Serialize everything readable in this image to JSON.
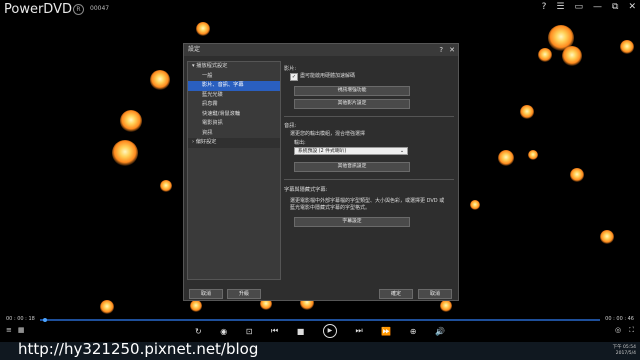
{
  "app": {
    "title": "PowerDVD",
    "badge": "R",
    "count": "00047"
  },
  "window_controls": [
    "?",
    "☰",
    "▭",
    "—",
    "⧉",
    "✕"
  ],
  "dialog": {
    "title": "設定",
    "help": "?",
    "close": "✕",
    "tree": [
      {
        "label": "播放程式設定",
        "type": "head",
        "expand": "▾"
      },
      {
        "label": "一般",
        "type": "item"
      },
      {
        "label": "影片、音訊、字幕",
        "type": "selected"
      },
      {
        "label": "藍光光碟",
        "type": "item"
      },
      {
        "label": "訊息霧",
        "type": "item"
      },
      {
        "label": "快速鍵/滑鼠滾輪",
        "type": "item"
      },
      {
        "label": "電影資訊",
        "type": "item"
      },
      {
        "label": "資訊",
        "type": "item"
      },
      {
        "label": "偏好設定",
        "type": "head-alt",
        "expand": "›"
      }
    ],
    "video": {
      "title": "影片:",
      "hw_checkbox_label": "盡可能啟用硬體加速解碼",
      "hw_checked": "✓",
      "btn1": "視訊增強功能",
      "btn2": "其他影片設定"
    },
    "audio": {
      "title": "音訊:",
      "desc": "選更您的輸出模組，混合增強選擇",
      "output_label": "輸出:",
      "output_value": "系統預設 (2 件式喇叭)",
      "btn": "其他音訊設定"
    },
    "subtitle": {
      "title": "字幕與隱藏式字幕:",
      "desc1": "選更電影檔中外部字幕檔的字型類型、大小與色彩，或選擇更 DVD 或",
      "desc2": "藍光電影中隱藏式字幕的字型格式。",
      "btn": "字幕設定"
    },
    "footer": {
      "cancel": "取消",
      "upgrade": "升級",
      "ok": "確定",
      "cancel2": "取消"
    }
  },
  "player": {
    "time_start": "00 : 00 : 18",
    "time_end": "00 : 00 : 46",
    "progress": 0.006
  },
  "watermark": "http://hy321250.pixnet.net/blog",
  "tray": {
    "time": "下午 05:54",
    "date": "2017/5/4"
  }
}
